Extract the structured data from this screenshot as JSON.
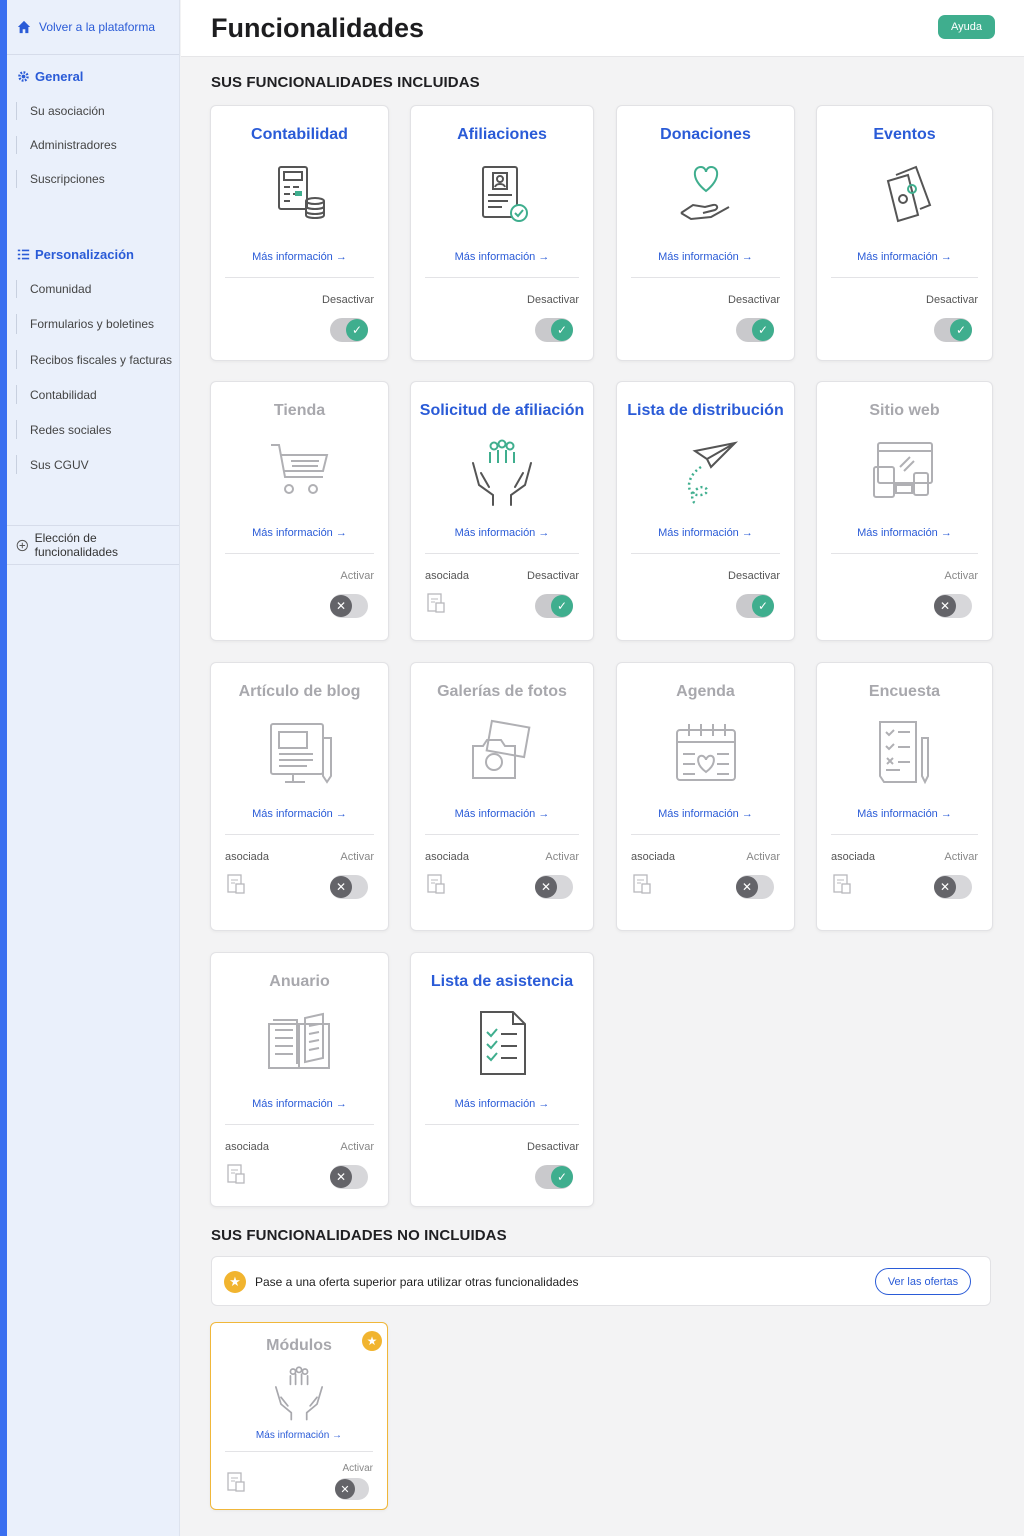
{
  "sidebar": {
    "back": "Volver a la plataforma",
    "general": {
      "title": "General",
      "items": [
        "Su asociación",
        "Administradores",
        "Suscripciones"
      ]
    },
    "personalization": {
      "title": "Personalización",
      "items": [
        "Comunidad",
        "Formularios y boletines",
        "Recibos fiscales y facturas",
        "Contabilidad",
        "Redes sociales",
        "Sus CGUV"
      ]
    },
    "choice": "Elección de funcionalidades"
  },
  "header": {
    "title": "Funcionalidades",
    "help": "Ayuda"
  },
  "included": {
    "title": "SUS FUNCIONALIDADES INCLUIDAS",
    "more": "Más información →",
    "assoc_label": "asociada",
    "cards": [
      {
        "title": "Contabilidad",
        "icon": "accounting-icon",
        "status": "Desactivar",
        "enabled": true,
        "assoc": false
      },
      {
        "title": "Afiliaciones",
        "icon": "membership-icon",
        "status": "Desactivar",
        "enabled": true,
        "assoc": false
      },
      {
        "title": "Donaciones",
        "icon": "donation-icon",
        "status": "Desactivar",
        "enabled": true,
        "assoc": false
      },
      {
        "title": "Eventos",
        "icon": "tickets-icon",
        "status": "Desactivar",
        "enabled": true,
        "assoc": false
      },
      {
        "title": "Tienda",
        "icon": "cart-icon",
        "status": "Activar",
        "enabled": false,
        "assoc": false
      },
      {
        "title": "Solicitud de afiliación",
        "icon": "hands-people-icon",
        "status": "Desactivar",
        "enabled": true,
        "assoc": true
      },
      {
        "title": "Lista de distribución",
        "icon": "paper-plane-icon",
        "status": "Desactivar",
        "enabled": true,
        "assoc": false
      },
      {
        "title": "Sitio web",
        "icon": "website-icon",
        "status": "Activar",
        "enabled": false,
        "assoc": false
      },
      {
        "title": "Artículo de blog",
        "icon": "blog-icon",
        "status": "Activar",
        "enabled": false,
        "assoc": true
      },
      {
        "title": "Galerías de fotos",
        "icon": "camera-icon",
        "status": "Activar",
        "enabled": false,
        "assoc": true
      },
      {
        "title": "Agenda",
        "icon": "calendar-icon",
        "status": "Activar",
        "enabled": false,
        "assoc": true
      },
      {
        "title": "Encuesta",
        "icon": "survey-icon",
        "status": "Activar",
        "enabled": false,
        "assoc": true
      },
      {
        "title": "Anuario",
        "icon": "book-icon",
        "status": "Activar",
        "enabled": false,
        "assoc": true
      },
      {
        "title": "Lista de asistencia",
        "icon": "checklist-icon",
        "status": "Desactivar",
        "enabled": true,
        "assoc": false
      }
    ]
  },
  "not_included": {
    "title": "SUS FUNCIONALIDADES NO INCLUIDAS",
    "banner_text": "Pase a una oferta superior para utilizar otras funcionalidades",
    "offers_button": "Ver las ofertas",
    "module": {
      "title": "Módulos",
      "more": "Más información →",
      "status": "Activar"
    }
  },
  "colors": {
    "accent": "#2a5bd7",
    "green": "#3fae8e",
    "premium": "#f1b42f"
  }
}
